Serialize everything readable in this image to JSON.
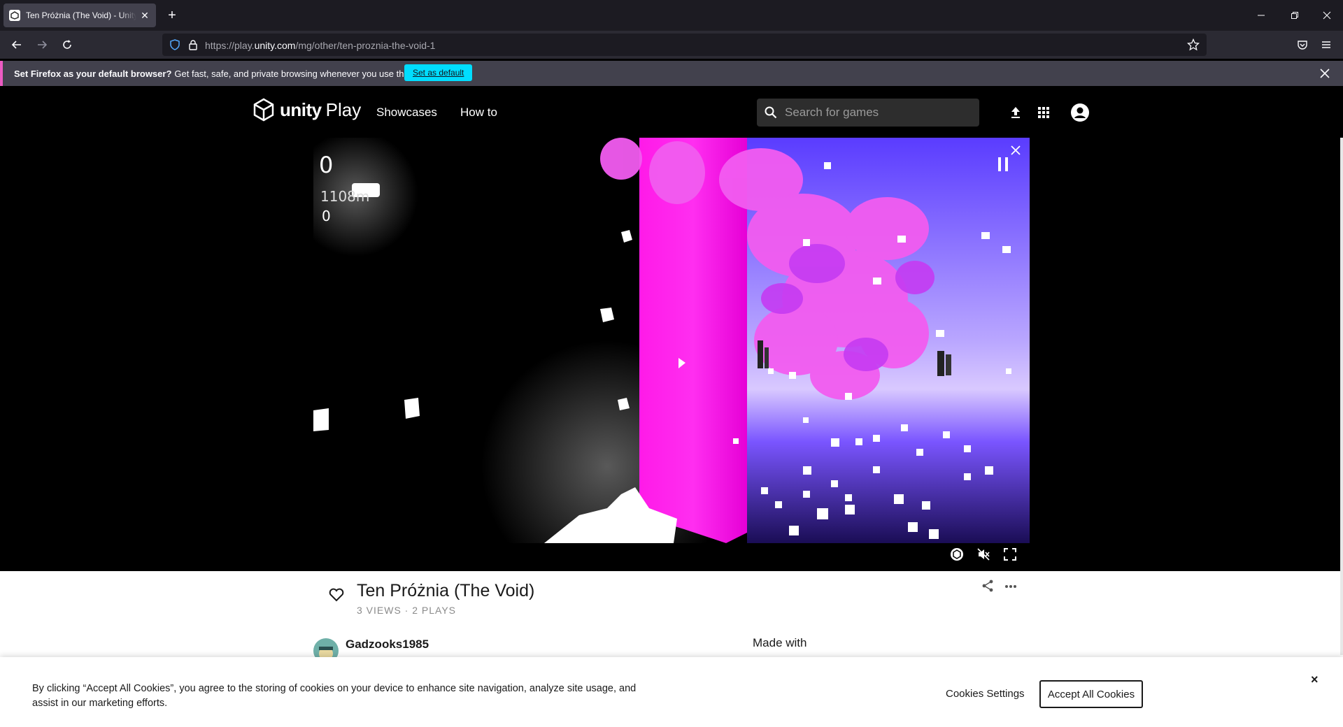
{
  "browser": {
    "tab_title": "Ten Próżnia (The Void) - Unity Play",
    "url_prefix": "https://play.",
    "url_domain": "unity.com",
    "url_path": "/mg/other/ten-proznia-the-void-1"
  },
  "notification": {
    "bold": "Set Firefox as your default browser?",
    "text": "Get fast, safe, and private browsing whenever you use the web.",
    "button": "Set as default"
  },
  "site": {
    "logo_text": "unity",
    "logo_suffix": "Play",
    "nav": [
      "Showcases",
      "How to"
    ],
    "search_placeholder": "Search for games"
  },
  "game_hud": {
    "score": "0",
    "distance": "1108m",
    "count": "0"
  },
  "game": {
    "title": "Ten Próżnia (The Void)",
    "stats": "3 VIEWS · 2 PLAYS",
    "author": "Gadzooks1985",
    "made_with_label": "Made with"
  },
  "cookie": {
    "text": "By clicking “Accept All Cookies”, you agree to the storing of cookies on your device to enhance site navigation, analyze site usage, and assist in our marketing efforts.",
    "settings": "Cookies Settings",
    "accept": "Accept All Cookies",
    "close": "×"
  },
  "colors": {
    "accent_firefox": "#00ddff",
    "magenta": "#ff1ae8",
    "purple_sky": "#7a5cff"
  }
}
